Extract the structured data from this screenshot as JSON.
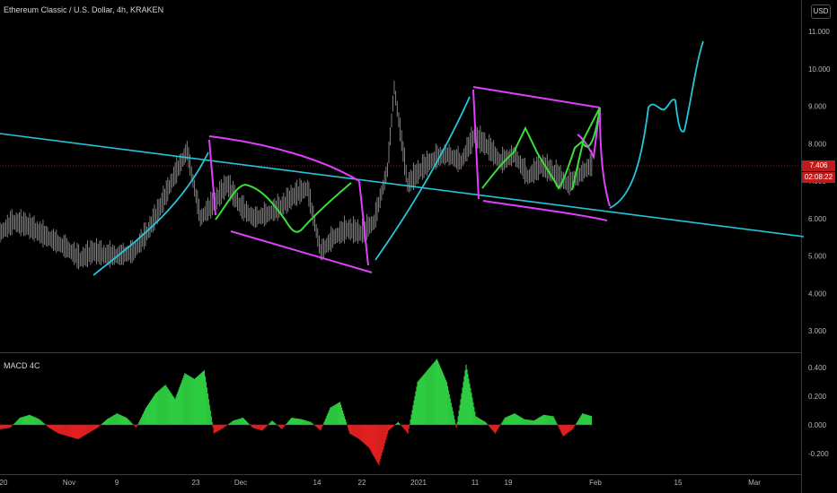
{
  "header": {
    "symbol_text": "Ethereum Classic / U.S. Dollar, 4h, KRAKEN",
    "currency_button": "USD"
  },
  "price_tags": {
    "last_price": "7.406",
    "countdown": "02:08:22"
  },
  "macd": {
    "title": "MACD 4C"
  },
  "colors": {
    "background": "#000000",
    "candles": "#8a8a8a",
    "trendline": "#26c6da",
    "channel": "#e040fb",
    "pattern": "#3cdc3c",
    "macd_positive": "#2ecc40",
    "macd_negative": "#e02020",
    "price_tag": "#c01a1a"
  },
  "chart_data": [
    {
      "type": "line",
      "title": "Ethereum Classic / U.S. Dollar, 4h, KRAKEN",
      "y_axis": {
        "ticks": [
          "11.000",
          "10.000",
          "9.000",
          "8.000",
          "7.000",
          "6.000",
          "5.000",
          "4.000",
          "3.000"
        ],
        "ylim": [
          2.5,
          11.3
        ],
        "position": "right"
      },
      "x_axis": {
        "ticks": [
          "20",
          "Nov",
          "9",
          "23",
          "Dec",
          "14",
          "22",
          "2021",
          "11",
          "19",
          "Feb",
          "15",
          "Mar"
        ]
      },
      "last_price": 7.406,
      "grid": false,
      "series": [
        {
          "key": "price",
          "x": [
            0,
            4,
            8,
            12,
            16,
            20,
            24,
            28,
            32,
            36,
            40,
            44,
            48,
            52,
            56,
            60,
            64,
            68,
            72,
            76,
            80,
            84,
            88,
            92,
            96,
            100,
            104,
            108,
            112,
            116,
            118,
            122,
            126,
            130,
            134,
            138,
            142,
            146,
            150,
            154,
            158,
            162,
            166,
            170,
            174,
            178,
            182,
            186,
            190,
            192,
            196,
            200,
            204,
            208,
            212,
            216,
            220,
            224,
            228,
            232,
            236,
            240
          ],
          "values": [
            5.6,
            5.9,
            5.8,
            5.6,
            5.4,
            5.2,
            4.9,
            5.1,
            5.0,
            5.0,
            5.1,
            5.6,
            6.3,
            7.1,
            7.8,
            6.0,
            6.4,
            6.9,
            6.3,
            6.0,
            6.1,
            6.3,
            6.6,
            6.8,
            5.1,
            5.5,
            5.7,
            5.6,
            5.9,
            7.3,
            9.5,
            6.9,
            7.3,
            7.6,
            7.7,
            7.5,
            8.2,
            7.9,
            7.5,
            7.7,
            7.1,
            7.4,
            7.2,
            6.9,
            7.2,
            7.5,
            7.3,
            6.9,
            7.1,
            8.2,
            8.6,
            8.9,
            9.0,
            8.9,
            9.1,
            8.3,
            9.7,
            10.3,
            11.0,
            10.7,
            10.9,
            11.0
          ]
        }
      ],
      "drawings": {
        "trendline": [
          [
            0,
            8.2
          ],
          [
            250,
            5.6
          ]
        ],
        "curves": [
          "cyan",
          "magenta",
          "green"
        ]
      }
    },
    {
      "type": "bar",
      "title": "MACD 4C",
      "y_axis": {
        "ticks": [
          "0.400",
          "0.200",
          "0.000",
          "-0.200"
        ],
        "ylim": [
          -0.32,
          0.5
        ]
      },
      "series": [
        {
          "name": "MACD 4C",
          "x": [
            0,
            3,
            6,
            9,
            12,
            15,
            18,
            21,
            24,
            27,
            30,
            33,
            36,
            39,
            42,
            45,
            48,
            51,
            54,
            57,
            60,
            63,
            66,
            69,
            72,
            75,
            78,
            81,
            84,
            87,
            90,
            93,
            96,
            99,
            102,
            105,
            108,
            111,
            114,
            117,
            120,
            123,
            126,
            129,
            132,
            135,
            138,
            141,
            144,
            147,
            150,
            153,
            156,
            159,
            162,
            165,
            168,
            171,
            174,
            177,
            180,
            183
          ],
          "values": [
            -0.03,
            -0.02,
            0.05,
            0.07,
            0.04,
            -0.02,
            -0.06,
            -0.08,
            -0.1,
            -0.06,
            -0.02,
            0.04,
            0.08,
            0.05,
            -0.02,
            0.12,
            0.22,
            0.28,
            0.18,
            0.36,
            0.32,
            0.38,
            -0.06,
            -0.02,
            0.03,
            0.05,
            -0.02,
            -0.04,
            0.03,
            -0.03,
            0.05,
            0.04,
            0.02,
            -0.04,
            0.12,
            0.16,
            -0.06,
            -0.1,
            -0.16,
            -0.28,
            -0.04,
            0.02,
            -0.06,
            0.3,
            0.38,
            0.46,
            0.3,
            -0.02,
            0.42,
            0.06,
            0.02,
            -0.06,
            0.05,
            0.08,
            0.04,
            0.03,
            0.07,
            0.06,
            -0.08,
            -0.03,
            0.08,
            0.06
          ]
        }
      ]
    }
  ]
}
